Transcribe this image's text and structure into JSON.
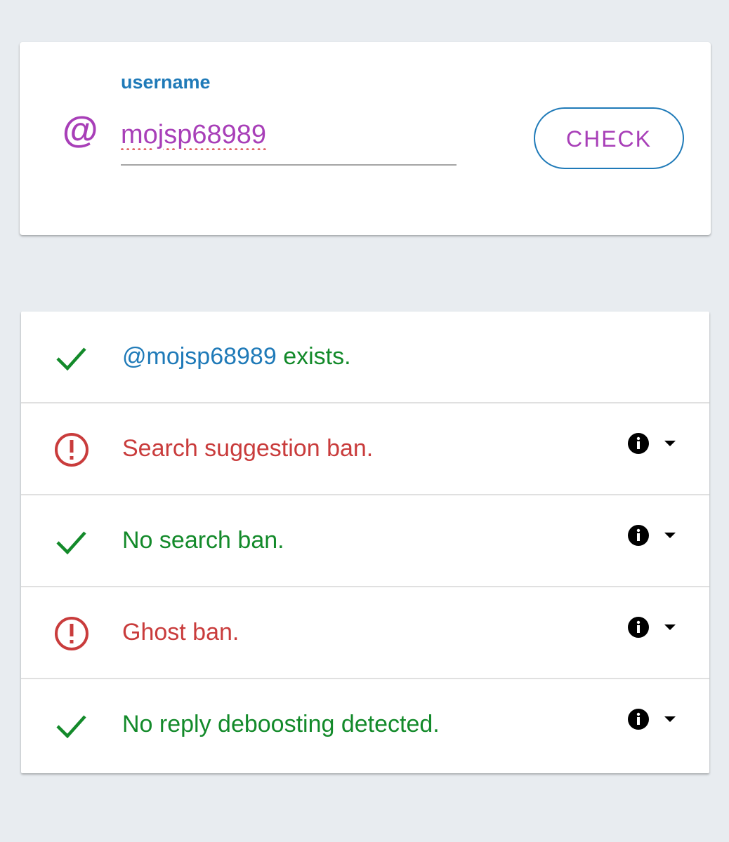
{
  "form": {
    "label": "username",
    "at_symbol": "@",
    "username_value": "mojsp68989",
    "check_label": "CHECK"
  },
  "results": [
    {
      "status": "ok",
      "icon": "checkmark-icon",
      "handle": "@mojsp68989",
      "text": " exists."
    },
    {
      "status": "bad",
      "icon": "alert-circle-icon",
      "text": "Search suggestion ban.",
      "has_info": true
    },
    {
      "status": "ok",
      "icon": "checkmark-icon",
      "text": "No search ban.",
      "has_info": true
    },
    {
      "status": "bad",
      "icon": "alert-circle-icon",
      "text": "Ghost ban.",
      "has_info": true
    },
    {
      "status": "ok",
      "icon": "checkmark-icon",
      "text": "No reply deboosting detected.",
      "has_info": true
    }
  ],
  "colors": {
    "accent_blue": "#1f7ab8",
    "accent_purple": "#a83fb8",
    "ok_green": "#138a2a",
    "bad_red": "#c93c3c",
    "background": "#e8ecf0"
  }
}
